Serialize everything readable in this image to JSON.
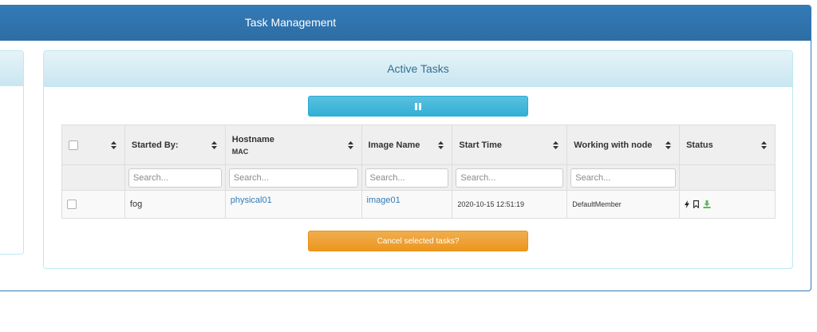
{
  "header": {
    "title": "Task Management"
  },
  "tasks_panel": {
    "title": "Active Tasks",
    "pause_button": {
      "icon": "pause-icon"
    },
    "cancel_button": {
      "label": "Cancel selected tasks?"
    }
  },
  "table": {
    "columns": [
      {
        "label": "",
        "sub": ""
      },
      {
        "label": "Started By:",
        "sub": ""
      },
      {
        "label": "Hostname",
        "sub": "MAC"
      },
      {
        "label": "Image Name",
        "sub": ""
      },
      {
        "label": "Start Time",
        "sub": ""
      },
      {
        "label": "Working with node",
        "sub": ""
      },
      {
        "label": "Status",
        "sub": ""
      }
    ],
    "search_placeholder": "Search...",
    "rows": [
      {
        "started_by": "fog",
        "hostname": "physical01",
        "image_name": "image01",
        "start_time": "2020-10-15 12:51:19",
        "node": "DefaultMember",
        "status_icons": [
          "bolt-icon",
          "bookmark-icon",
          "download-icon"
        ]
      }
    ]
  },
  "colors": {
    "primary": "#337ab7",
    "info": "#5bc0de",
    "warning": "#f0ad4e",
    "panel_heading": "#d9edf7",
    "link": "#337ab7",
    "download_icon": "#5cb85c"
  }
}
